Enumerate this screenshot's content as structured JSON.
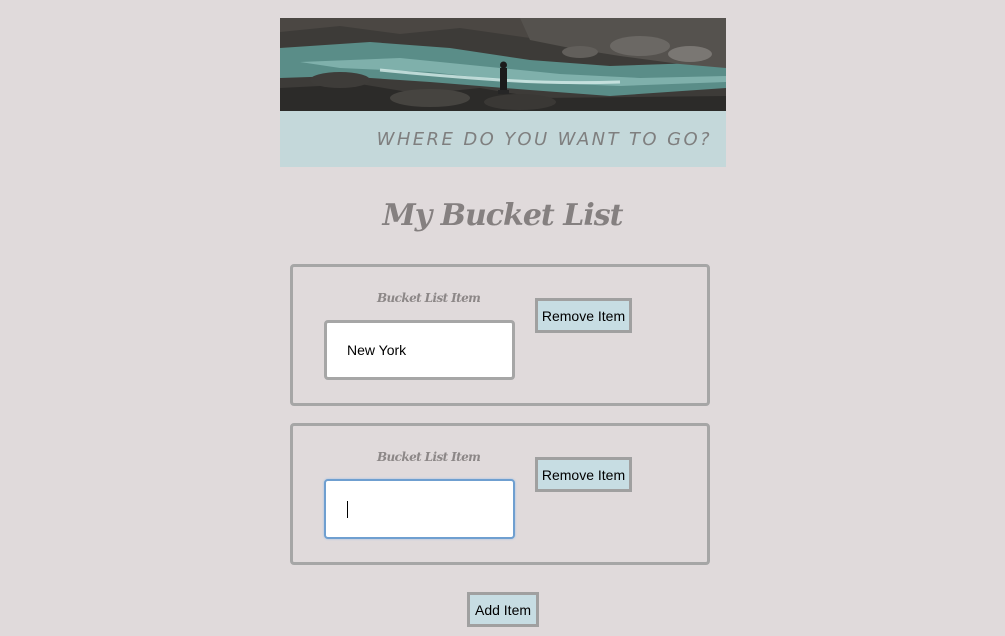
{
  "header": {
    "image_name": "river-landscape-image",
    "banner_text": "WHERE DO YOU WANT TO GO?"
  },
  "main": {
    "title": "My Bucket List",
    "items": [
      {
        "label": "Bucket List Item",
        "value": "New York",
        "remove_label": "Remove Item",
        "focused": false
      },
      {
        "label": "Bucket List Item",
        "value": "",
        "remove_label": "Remove Item",
        "focused": true
      }
    ],
    "add_label": "Add Item"
  },
  "colors": {
    "background": "#e0dadb",
    "banner": "#c4d8da",
    "button": "#c7dde3",
    "border": "#a6a6a6",
    "focus": "#6f9fd0",
    "text_muted": "#7f7f7f"
  }
}
